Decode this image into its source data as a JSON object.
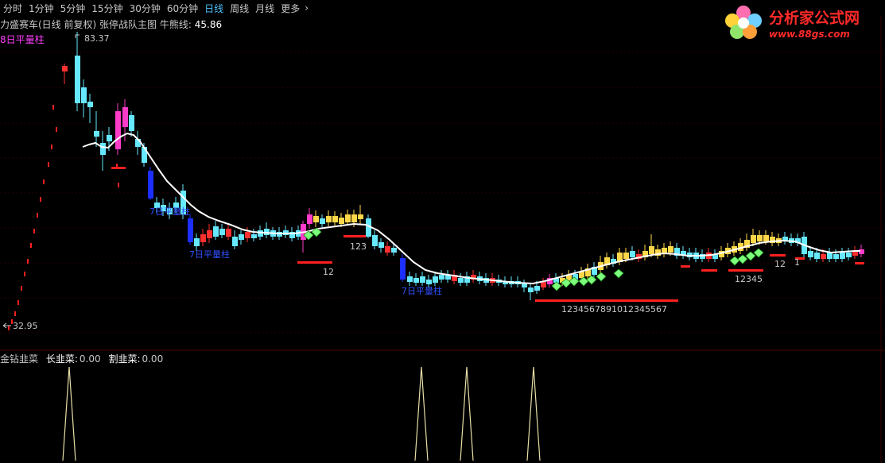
{
  "toolbar": {
    "periods": [
      "分时",
      "1分钟",
      "5分钟",
      "15分钟",
      "30分钟",
      "60分钟",
      "日线",
      "周线",
      "月线",
      "更多"
    ],
    "active": "日线"
  },
  "logo": {
    "title": "分析家公式网",
    "url": "www.88gs.com"
  },
  "main_header": {
    "stock": "力盛赛车(日线 前复权)",
    "indicator": "张停战队主图",
    "bull_bear_label": "牛熊线:",
    "bull_bear_value": "45.86"
  },
  "legend_purple": "8日平量柱",
  "price_high": "83.37",
  "price_low": "32.95",
  "annotations": {
    "blue_labels": [
      "7日平量柱",
      "7日平量柱",
      "7日平量柱"
    ],
    "counts": [
      "12",
      "123",
      "1234567891012345567",
      "12345",
      "12",
      "1"
    ]
  },
  "sub_header": {
    "name": "金钻韭菜",
    "items": [
      {
        "label": "长韭菜:",
        "value": "0.00"
      },
      {
        "label": "割韭菜:",
        "value": "0.00"
      }
    ]
  },
  "colors": {
    "up_cyan": "#66e8ff",
    "down_red": "#ff3030",
    "pink": "#ff3cc8",
    "yellow": "#ffd84a",
    "blue": "#1c2fff",
    "green_diamond": "#7dff7d",
    "ma_line": "#ffffff",
    "spike": "#e8e0a8"
  }
}
